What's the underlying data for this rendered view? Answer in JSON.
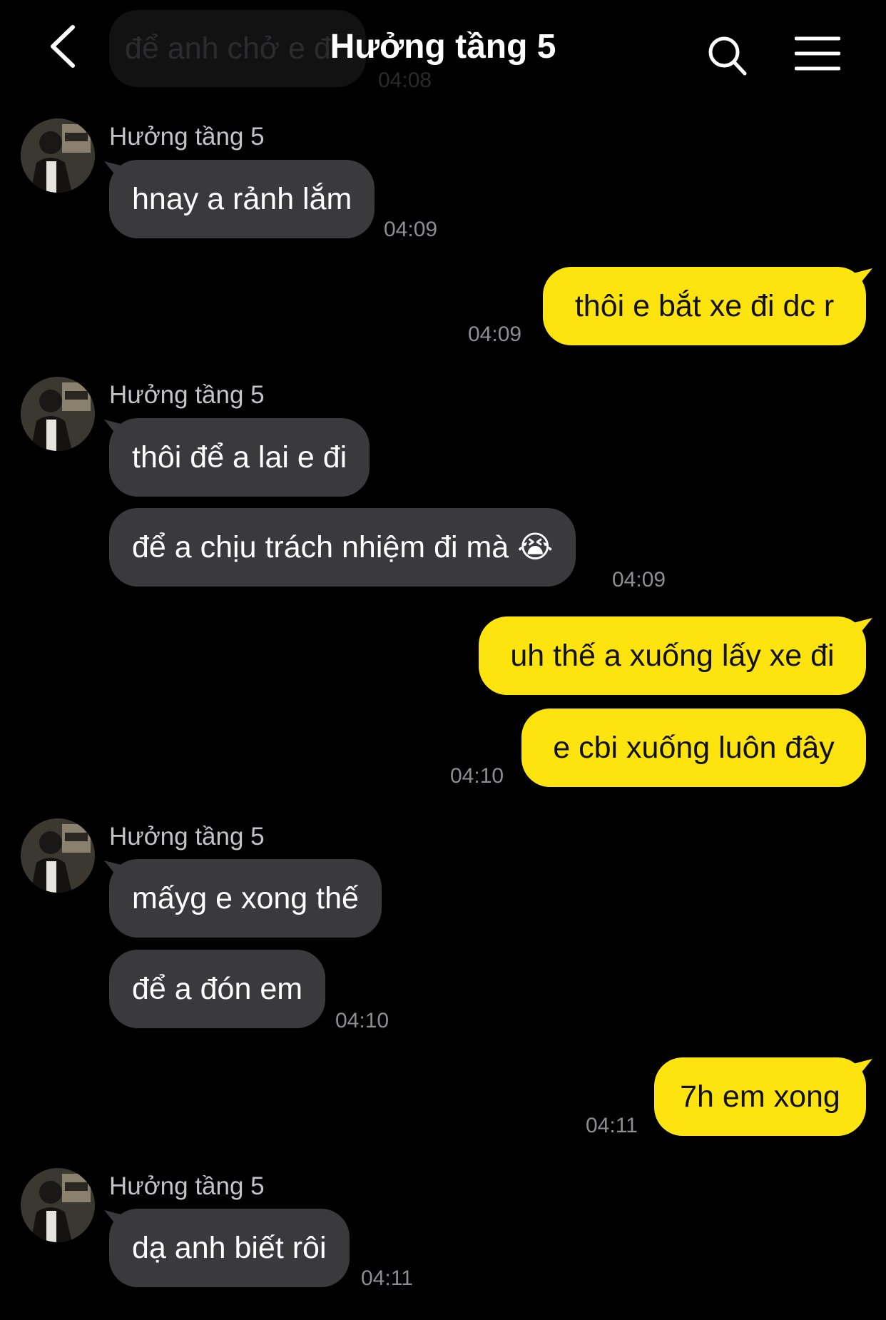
{
  "header": {
    "title": "Hưởng tầng 5",
    "back_icon": "chevron-left-icon",
    "search_icon": "search-icon",
    "menu_icon": "hamburger-menu-icon",
    "ghost_message": "để anh chở e đi",
    "ghost_time": "04:08"
  },
  "messages": [
    {
      "sender": "Hưởng tầng 5",
      "text": "hnay a rảnh lắm",
      "time": "04:09"
    },
    {
      "text": "thôi e bắt xe đi dc r",
      "time": "04:09"
    },
    {
      "sender": "Hưởng tầng 5",
      "text": "thôi để a lai e đi"
    },
    {
      "text": "để a chịu trách nhiệm đi mà 😭",
      "time": "04:09"
    },
    {
      "text": "uh thế a xuống lấy xe đi"
    },
    {
      "text": "e cbi xuống luôn đây",
      "time": "04:10"
    },
    {
      "sender": "Hưởng tầng 5",
      "text": "mấyg e xong thế"
    },
    {
      "text": "để a đón em",
      "time": "04:10"
    },
    {
      "text": "7h em xong",
      "time": "04:11"
    },
    {
      "sender": "Hưởng tầng 5",
      "text": "dạ anh biết rôi",
      "time": "04:11"
    }
  ],
  "colors": {
    "background": "#000000",
    "incoming_bubble": "#3a3a3c",
    "outgoing_bubble": "#fde40e",
    "timestamp": "#8d8d92"
  }
}
